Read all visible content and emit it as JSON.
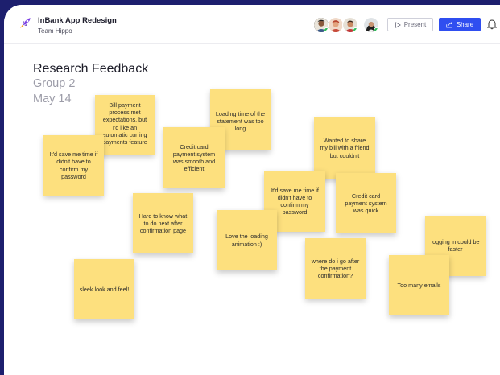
{
  "header": {
    "app_title": "InBank App Redesign",
    "team_name": "Team Hippo",
    "present_label": "Present",
    "share_label": "Share",
    "logo_icon": "rocket-icon",
    "present_icon": "play-icon",
    "share_icon": "share-icon",
    "bell_icon": "bell-icon"
  },
  "colors": {
    "background": "#1d1f6e",
    "share_button": "#2f4ef0",
    "sticky_note": "#fde07e",
    "online_dot": "#2fbf5a"
  },
  "board": {
    "title": "Research Feedback",
    "group": "Group 2",
    "date": "May 14"
  },
  "notes": [
    {
      "text": "Bill payment process met expectations, but I'd like an automatic curring payments feature"
    },
    {
      "text": "Loading time of the statement was too long"
    },
    {
      "text": "It'd save me time if didn't have to confirm my password"
    },
    {
      "text": "Credit card payment system was smooth and efficient"
    },
    {
      "text": "Wanted to share my bill with a friend but couldn't"
    },
    {
      "text": "It'd save me time if didn't have to confirm my password"
    },
    {
      "text": "Credit card payment system was quick"
    },
    {
      "text": "Hard to know what to do next after confirmation page"
    },
    {
      "text": "Love the loading animation :)"
    },
    {
      "text": "logging in could be faster"
    },
    {
      "text": "where do i go after the payment confirmation?"
    },
    {
      "text": "Too many emails"
    },
    {
      "text": "sleek look and feel!"
    }
  ]
}
